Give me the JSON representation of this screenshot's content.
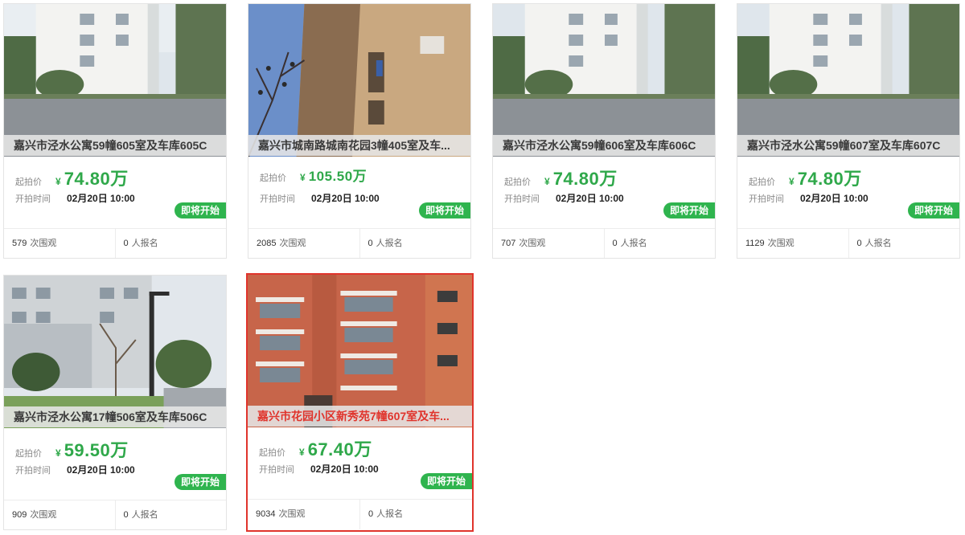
{
  "labels": {
    "start_price": "起拍价",
    "start_time": "开拍时间",
    "views_suffix": "次围观",
    "signup_suffix": "人报名",
    "currency_icon": "yen-icon",
    "currency_symbol": "¥"
  },
  "colors": {
    "price": "#2fa84a",
    "badge": "#2fb44e",
    "selected_border": "#e0342c"
  },
  "listings": [
    {
      "title": "嘉兴市泾水公寓59幢605室及车库605C",
      "price": "74.80万",
      "time": "02月20日 10:00",
      "badge": "即将开始",
      "views": "579",
      "signups": "0"
    },
    {
      "title": "嘉兴市城南路城南花园3幢405室及车...",
      "price": "105.50万",
      "time": "02月20日 10:00",
      "badge": "即将开始",
      "views": "2085",
      "signups": "0"
    },
    {
      "title": "嘉兴市泾水公寓59幢606室及车库606C",
      "price": "74.80万",
      "time": "02月20日 10:00",
      "badge": "即将开始",
      "views": "707",
      "signups": "0"
    },
    {
      "title": "嘉兴市泾水公寓59幢607室及车库607C",
      "price": "74.80万",
      "time": "02月20日 10:00",
      "badge": "即将开始",
      "views": "1129",
      "signups": "0"
    },
    {
      "title": "嘉兴市泾水公寓17幢506室及车库506C",
      "price": "59.50万",
      "time": "02月20日 10:00",
      "badge": "即将开始",
      "views": "909",
      "signups": "0"
    },
    {
      "title": "嘉兴市花园小区新秀苑7幢607室及车...",
      "price": "67.40万",
      "time": "02月20日 10:00",
      "badge": "即将开始",
      "views": "9034",
      "signups": "0"
    }
  ]
}
